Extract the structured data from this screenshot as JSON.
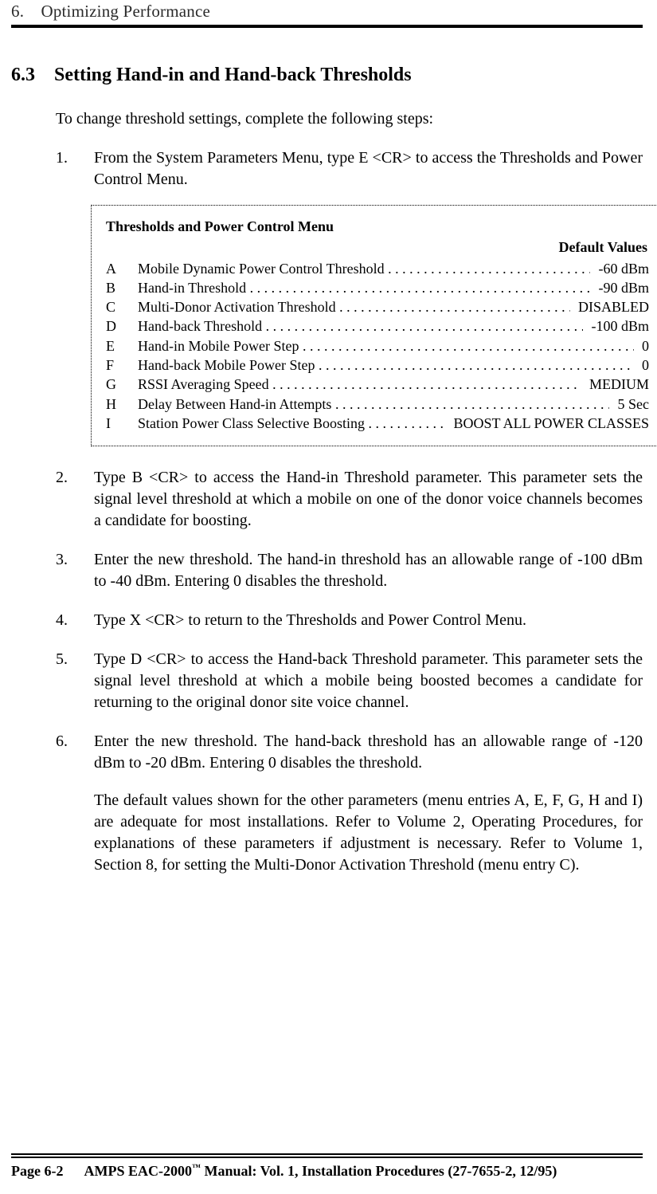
{
  "running_head": {
    "num": "6.",
    "title": "Optimizing Performance"
  },
  "section": {
    "num": "6.3",
    "title": "Setting Hand-in and Hand-back Thresholds"
  },
  "intro": "To change threshold settings, complete the following steps:",
  "steps": {
    "s1a": "From the System Parameters Menu, type ",
    "s1cmd": "E <CR>",
    "s1b": " to access the Thresholds       and Power Control Menu.",
    "s2a": "Type ",
    "s2cmd": "B <CR>",
    "s2b": " to access the Hand-in Threshold parameter.  This parameter sets the signal level threshold at which a mobile on one of the donor voice channels becomes a candidate for boosting.",
    "s3": "Enter the new threshold.  The hand-in threshold has an allowable range of -100 dBm to -40 dBm.  Entering 0 disables the threshold.",
    "s4a": "Type ",
    "s4cmd": "X <CR>",
    "s4b": " to return to the Thresholds and Power Control Menu.",
    "s5a": "Type ",
    "s5cmd": "D <CR>",
    "s5b": " to access the Hand-back Threshold parameter.  This parameter sets the signal level threshold at which a mobile being boosted becomes a candidate for returning to the original donor site voice channel.",
    "s6": "Enter the new threshold.  The hand-back threshold has an allowable range of -120 dBm to -20 dBm.  Entering 0 disables the threshold.",
    "note": "The default values shown for the other parameters (menu entries A, E, F, G, H and I) are adequate for most installations.  Refer to Volume 2, Operating Procedures, for explanations of these parameters if adjustment is necessary.  Refer to Volume 1, Section 8, for setting the Multi-Donor Activation Threshold (menu entry C)."
  },
  "menu": {
    "title": "Thresholds and Power Control Menu",
    "def_header": "Default Values",
    "rows": [
      {
        "k": "A",
        "label": "Mobile Dynamic Power Control Threshold",
        "val": "-60 dBm"
      },
      {
        "k": "B",
        "label": "Hand-in Threshold",
        "val": "-90 dBm"
      },
      {
        "k": "C",
        "label": "Multi-Donor Activation Threshold",
        "val": "DISABLED"
      },
      {
        "k": "D",
        "label": "Hand-back Threshold",
        "val": "-100 dBm"
      },
      {
        "k": "E",
        "label": "Hand-in Mobile Power Step",
        "val": "0"
      },
      {
        "k": "F",
        "label": "Hand-back Mobile Power Step",
        "val": "0"
      },
      {
        "k": "G",
        "label": "RSSI Averaging Speed",
        "val": "MEDIUM"
      },
      {
        "k": "H",
        "label": "Delay Between Hand-in Attempts",
        "val": "5 Sec"
      },
      {
        "k": "I",
        "label": "Station Power Class Selective Boosting",
        "val": "BOOST ALL POWER CLASSES"
      }
    ]
  },
  "footer": {
    "page": "Page 6-2",
    "manual_a": "AMPS EAC-2000",
    "tm": "™",
    "manual_b": " Manual:  Vol. 1, Installation Procedures (27-7655-2, 12/95)"
  }
}
